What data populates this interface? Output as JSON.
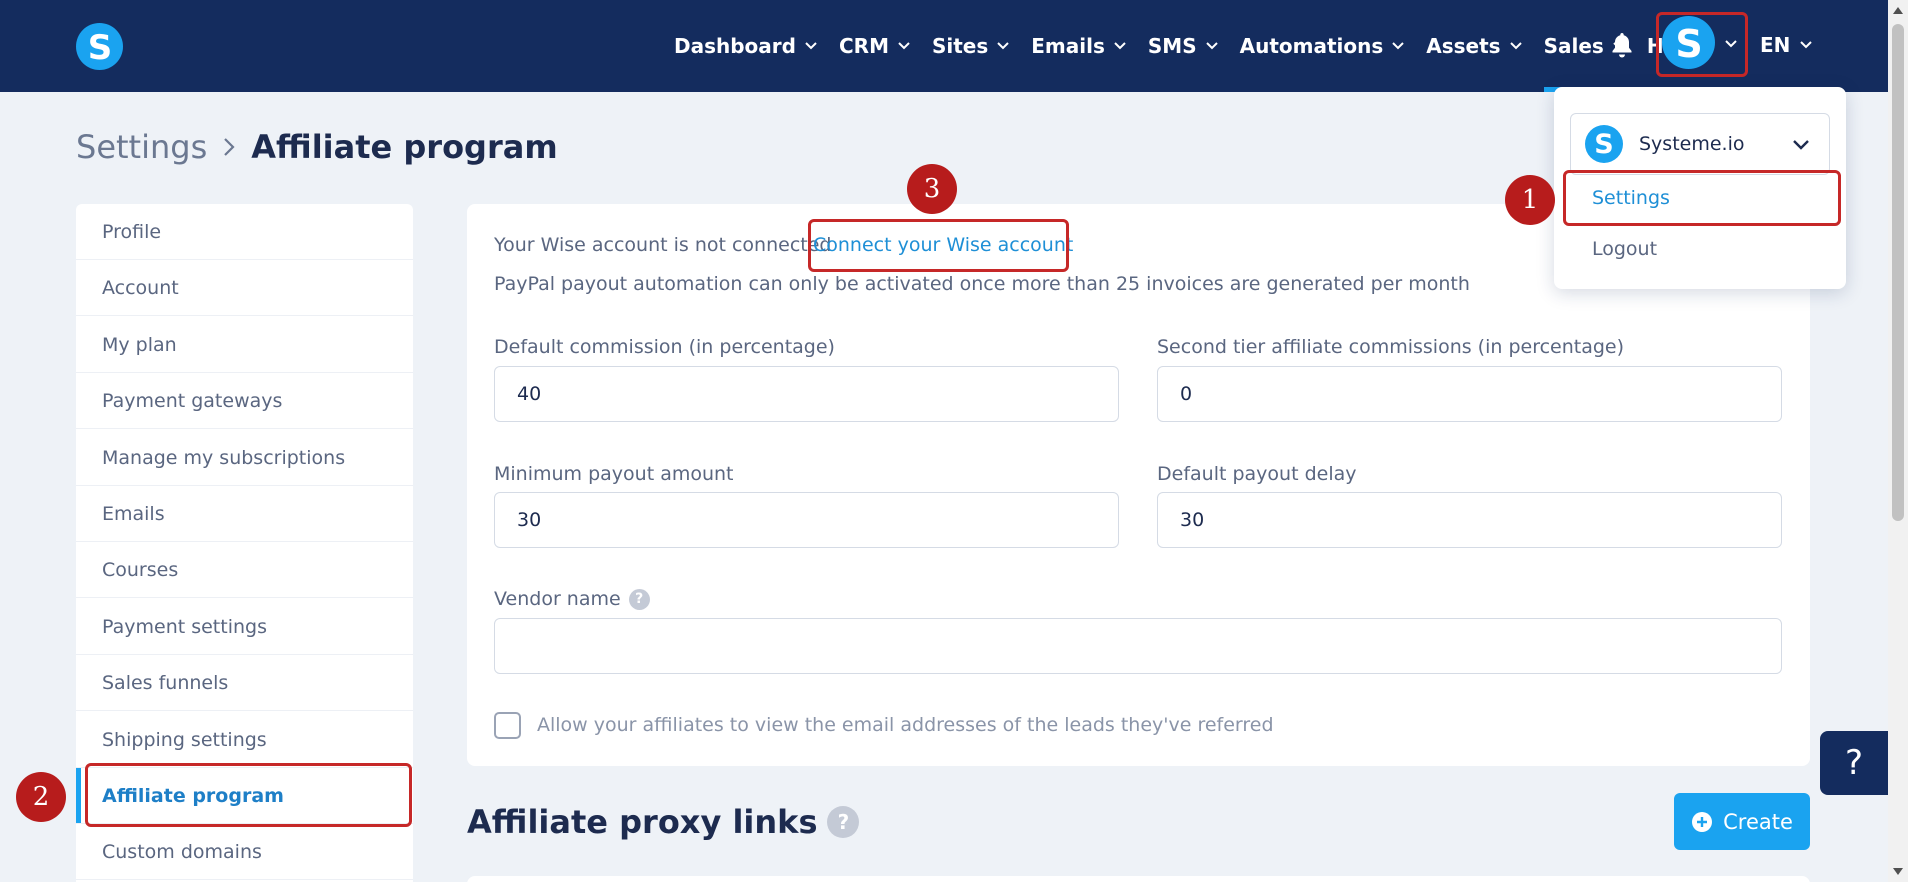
{
  "nav": {
    "items": [
      {
        "label": "Dashboard",
        "has_dropdown": true
      },
      {
        "label": "CRM",
        "has_dropdown": true
      },
      {
        "label": "Sites",
        "has_dropdown": true
      },
      {
        "label": "Emails",
        "has_dropdown": true
      },
      {
        "label": "SMS",
        "has_dropdown": true
      },
      {
        "label": "Automations",
        "has_dropdown": true
      },
      {
        "label": "Assets",
        "has_dropdown": true
      },
      {
        "label": "Sales",
        "has_dropdown": true,
        "active": true
      },
      {
        "label": "Help",
        "has_dropdown": false
      }
    ],
    "lang": "EN",
    "logo_letter": "S",
    "avatar_letter": "S"
  },
  "breadcrumb": {
    "parent": "Settings",
    "current": "Affiliate program"
  },
  "sidebar": {
    "items": [
      {
        "label": "Profile"
      },
      {
        "label": "Account"
      },
      {
        "label": "My plan"
      },
      {
        "label": "Payment gateways"
      },
      {
        "label": "Manage my subscriptions"
      },
      {
        "label": "Emails"
      },
      {
        "label": "Courses"
      },
      {
        "label": "Payment settings"
      },
      {
        "label": "Sales funnels"
      },
      {
        "label": "Shipping settings"
      },
      {
        "label": "Affiliate program",
        "active": true
      },
      {
        "label": "Custom domains"
      }
    ]
  },
  "affiliate": {
    "wise_status": "Your Wise account is not connected",
    "wise_link": "Connect your Wise account",
    "paypal_note": "PayPal payout automation can only be activated once more than 25 invoices are generated per month",
    "default_commission_label": "Default commission (in percentage)",
    "default_commission_value": "40",
    "second_tier_label": "Second tier affiliate commissions (in percentage)",
    "second_tier_value": "0",
    "min_payout_label": "Minimum payout amount",
    "min_payout_value": "30",
    "payout_delay_label": "Default payout delay",
    "payout_delay_value": "30",
    "vendor_name_label": "Vendor name",
    "vendor_name_value": "",
    "help_glyph": "?",
    "allow_view_emails_label": "Allow your affiliates to view the email addresses of the leads they've referred",
    "allow_view_emails_checked": false
  },
  "proxy_links": {
    "title": "Affiliate proxy links",
    "create_label": "Create"
  },
  "account_menu": {
    "account_name": "Systeme.io",
    "settings_label": "Settings",
    "logout_label": "Logout"
  },
  "annotations": {
    "badge_1": "1",
    "badge_2": "2",
    "badge_3": "3"
  },
  "floating_help": "?",
  "colors": {
    "nav_bg": "#142c5e",
    "accent": "#1aa3f0",
    "link": "#1e8fd6",
    "annotation_red": "#c62828",
    "page_bg": "#eef2f7"
  }
}
